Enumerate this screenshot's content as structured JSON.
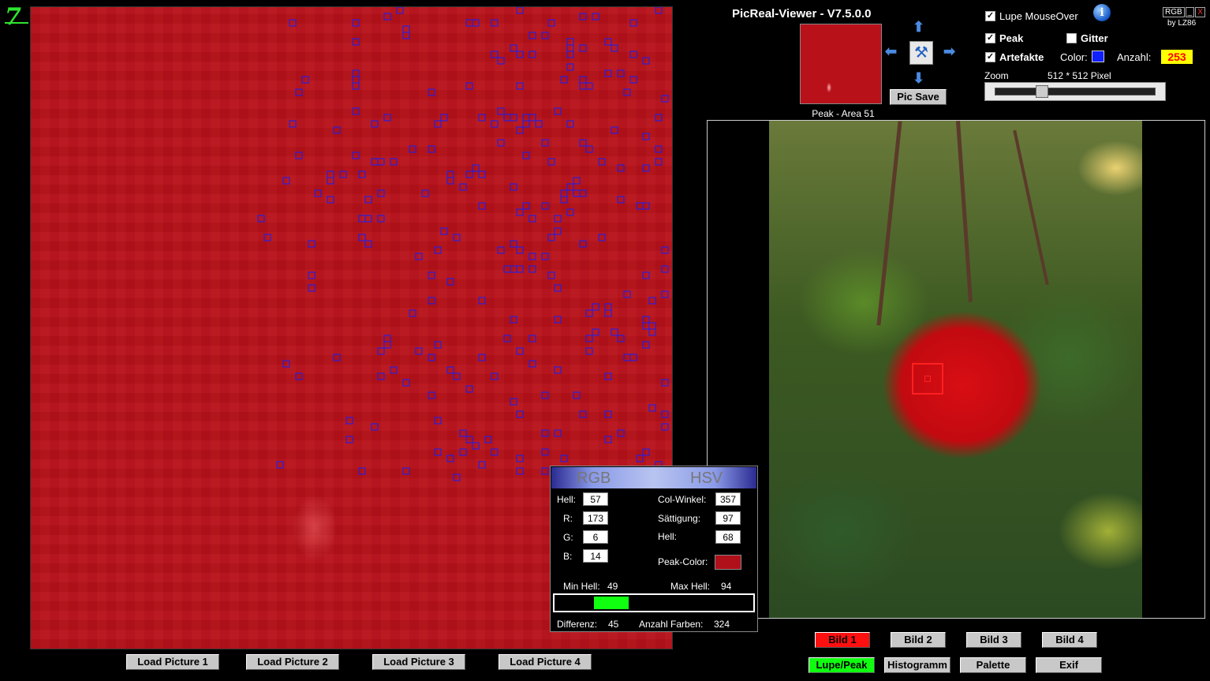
{
  "app": {
    "title": "PicReal-Viewer - V7.5.0.0",
    "logo_glyph": "7",
    "by": "by LZ86",
    "window_controls": [
      "RGB",
      "_",
      "X"
    ]
  },
  "thumbnail": {
    "caption": "Peak - Area 51"
  },
  "pic_save_label": "Pic Save",
  "options": {
    "lupe_mouseover": {
      "label": "Lupe MouseOver",
      "checked": true
    },
    "peak": {
      "label": "Peak",
      "checked": true
    },
    "gitter": {
      "label": "Gitter",
      "checked": false
    },
    "artefakte": {
      "label": "Artefakte",
      "checked": true
    },
    "color_label": "Color:",
    "color_value": "#1020ff",
    "anzahl_label": "Anzahl:",
    "anzahl_value": "253"
  },
  "zoom": {
    "label": "Zoom",
    "value_text": "512 * 512 Pixel"
  },
  "load_buttons": [
    "Load Picture 1",
    "Load Picture 2",
    "Load Picture 3",
    "Load Picture 4"
  ],
  "bild_buttons": [
    "Bild 1",
    "Bild 2",
    "Bild 3",
    "Bild 4"
  ],
  "mode_buttons": [
    "Lupe/Peak",
    "Histogramm",
    "Palette",
    "Exif"
  ],
  "color_panel": {
    "tabs": [
      "RGB",
      "HSV"
    ],
    "rgb": [
      {
        "label": "Hell:",
        "value": "57"
      },
      {
        "label": "R:",
        "value": "173"
      },
      {
        "label": "G:",
        "value": "6"
      },
      {
        "label": "B:",
        "value": "14"
      }
    ],
    "hsv": [
      {
        "label": "Col-Winkel:",
        "value": "357"
      },
      {
        "label": "Sättigung:",
        "value": "97"
      },
      {
        "label": "Hell:",
        "value": "68"
      }
    ],
    "peak_color_label": "Peak-Color:",
    "peak_color_value": "#b0101a",
    "min_hell_label": "Min Hell:",
    "min_hell_value": "49",
    "max_hell_label": "Max Hell:",
    "max_hell_value": "94",
    "differenz_label": "Differenz:",
    "differenz_value": "45",
    "anzahl_farben_label": "Anzahl Farben:",
    "anzahl_farben_value": "324"
  }
}
